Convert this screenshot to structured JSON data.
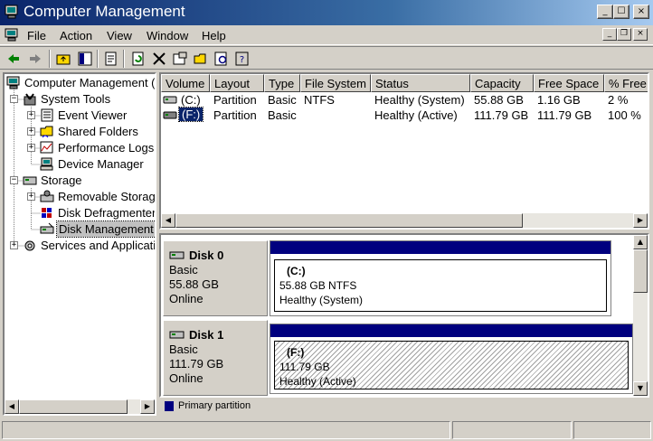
{
  "window": {
    "title": "Computer Management"
  },
  "menu": [
    "File",
    "Action",
    "View",
    "Window",
    "Help"
  ],
  "caption_buttons": {
    "minimize": "_",
    "maximize": "☐",
    "close": "×"
  },
  "mdi_buttons": {
    "minimize": "_",
    "restore": "❐",
    "close": "×"
  },
  "toolbar": [
    "back-icon",
    "forward-icon",
    "up-folder-icon",
    "show-hide-tree-icon",
    "properties-icon",
    "refresh-icon",
    "delete-icon",
    "properties2-icon",
    "open-icon",
    "search-icon",
    "help-icon"
  ],
  "tree": [
    {
      "label": "Computer Management (",
      "icon": "computer-icon",
      "level": 0,
      "expander": ""
    },
    {
      "label": "System Tools",
      "icon": "tools-icon",
      "level": 1,
      "expander": "−"
    },
    {
      "label": "Event Viewer",
      "icon": "event-viewer-icon",
      "level": 2,
      "expander": "+"
    },
    {
      "label": "Shared Folders",
      "icon": "shared-folders-icon",
      "level": 2,
      "expander": "+"
    },
    {
      "label": "Performance Logs",
      "icon": "performance-icon",
      "level": 2,
      "expander": "+"
    },
    {
      "label": "Device Manager",
      "icon": "device-manager-icon",
      "level": 2,
      "expander": ""
    },
    {
      "label": "Storage",
      "icon": "storage-icon",
      "level": 1,
      "expander": "−"
    },
    {
      "label": "Removable Storag",
      "icon": "removable-storage-icon",
      "level": 2,
      "expander": "+"
    },
    {
      "label": "Disk Defragmenter",
      "icon": "defrag-icon",
      "level": 2,
      "expander": ""
    },
    {
      "label": "Disk Management",
      "icon": "disk-management-icon",
      "level": 2,
      "expander": "",
      "selected": true
    },
    {
      "label": "Services and Applicati",
      "icon": "services-icon",
      "level": 1,
      "expander": "+"
    }
  ],
  "list": {
    "columns": [
      "Volume",
      "Layout",
      "Type",
      "File System",
      "Status",
      "Capacity",
      "Free Space",
      "% Free"
    ],
    "rows": [
      [
        "(C:)",
        "Partition",
        "Basic",
        "NTFS",
        "Healthy (System)",
        "55.88 GB",
        "1.16 GB",
        "2 %"
      ],
      [
        "(F:)",
        "Partition",
        "Basic",
        "",
        "Healthy (Active)",
        "111.79 GB",
        "111.79 GB",
        "100 %"
      ]
    ]
  },
  "disks": [
    {
      "name": "Disk 0",
      "type": "Basic",
      "size": "55.88 GB",
      "state": "Online",
      "volume": {
        "label": "(C:)",
        "size": "55.88 GB NTFS",
        "status": "Healthy (System)"
      }
    },
    {
      "name": "Disk 1",
      "type": "Basic",
      "size": "111.79 GB",
      "state": "Online",
      "volume": {
        "label": "(F:)",
        "size": "111.79 GB",
        "status": "Healthy (Active)"
      }
    }
  ],
  "legend": {
    "label": "Primary partition",
    "color": "#00007f"
  },
  "colors": {
    "titlebar_start": "#0a246a",
    "titlebar_end": "#a6caf0",
    "partition_bar": "#00007f",
    "face": "#d4d0c8"
  }
}
